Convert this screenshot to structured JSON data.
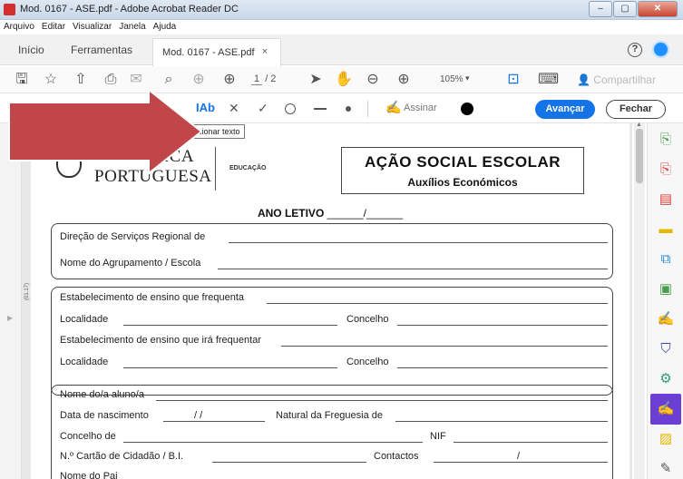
{
  "window": {
    "title": "Mod. 0167 - ASE.pdf - Adobe Acrobat Reader DC",
    "controls": [
      "–",
      "▢",
      "✕"
    ]
  },
  "menu": [
    "Arquivo",
    "Editar",
    "Visualizar",
    "Janela",
    "Ajuda"
  ],
  "tabs": {
    "home": "Início",
    "tools": "Ferramentas",
    "document": "Mod. 0167 - ASE.pdf",
    "close_glyph": "×"
  },
  "toolbar": {
    "page_current": "1",
    "page_total": "/ 2",
    "zoom": "105%",
    "share": "Compartilhar"
  },
  "fill_sign": {
    "text_tool": "IAb",
    "tooltip": "Adicionar texto",
    "sign_label": "Assinar",
    "next_button": "Avançar",
    "close_button": "Fechar",
    "arrow_color": "#c0464a",
    "accent_color": "#1473e6"
  },
  "form": {
    "header_line1": "REPÚBLICA",
    "header_line2": "PORTUGUESA",
    "department": "EDUCAÇÃO",
    "title": "AÇÃO SOCIAL ESCOLAR",
    "subtitle": "Auxílios Económicos",
    "school_year_label": "ANO LETIVO",
    "school_year_blank": "______/______",
    "side_code": "(01.17)",
    "fields": {
      "direcao": "Direção de Serviços Regional de",
      "agrupamento": "Nome do Agrupamento / Escola",
      "estab_frequenta": "Estabelecimento de ensino que frequenta",
      "localidade1": "Localidade",
      "concelho1": "Concelho",
      "estab_ira": "Estabelecimento de ensino que irá frequentar",
      "localidade2": "Localidade",
      "concelho2": "Concelho",
      "nome_aluno": "Nome do/a aluno/a",
      "data_nasc": "Data de nascimento",
      "data_nasc_slashes": "/          /",
      "freguesia": "Natural da Freguesia de",
      "concelho3": "Concelho de",
      "nif": "NIF",
      "cartao": "N.º Cartão de Cidadão / B.I.",
      "contactos": "Contactos",
      "contactos_slash": "/",
      "nome_pai": "Nome do Pai"
    }
  },
  "right_tools": [
    {
      "name": "export-pdf-icon",
      "glyph": "⎘",
      "color": "#4a9e4a"
    },
    {
      "name": "create-pdf-icon",
      "glyph": "⎘",
      "color": "#d8453b"
    },
    {
      "name": "organize-pages-icon",
      "glyph": "▤",
      "color": "#d8453b"
    },
    {
      "name": "comment-icon",
      "glyph": "▬",
      "color": "#e6b800"
    },
    {
      "name": "combine-files-icon",
      "glyph": "⧉",
      "color": "#1e88e5"
    },
    {
      "name": "edit-pdf-icon",
      "glyph": "▣",
      "color": "#4a9e4a"
    },
    {
      "name": "send-for-signature-icon",
      "glyph": "✍",
      "color": "#8e24aa"
    },
    {
      "name": "protect-icon",
      "glyph": "⛉",
      "color": "#3949ab"
    },
    {
      "name": "optimize-icon",
      "glyph": "⚙",
      "color": "#2e9e6e"
    },
    {
      "name": "fill-sign-icon",
      "glyph": "✍",
      "color": "#ffffff"
    },
    {
      "name": "share-file-icon",
      "glyph": "▨",
      "color": "#e6b800"
    },
    {
      "name": "more-tools-icon",
      "glyph": "✎",
      "color": "#555555"
    }
  ]
}
